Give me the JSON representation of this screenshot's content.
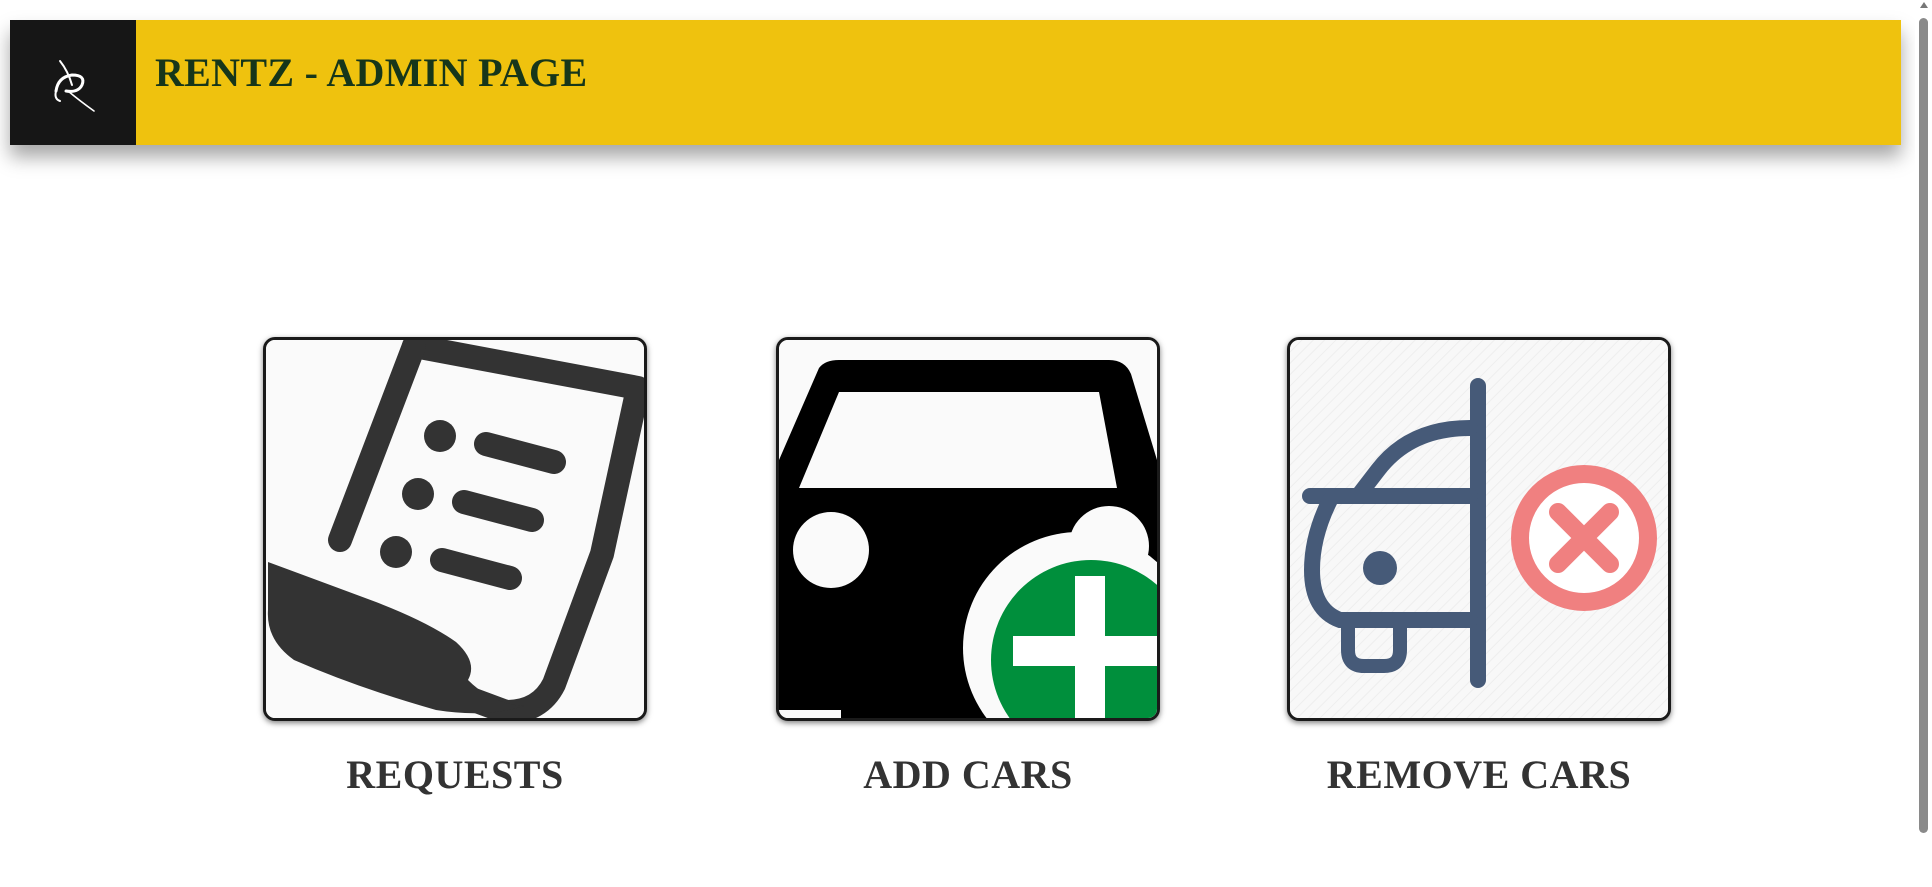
{
  "header": {
    "title": "RENTZ - ADMIN PAGE",
    "background_color": "#efc20e",
    "logo_background": "#161616",
    "logo_icon": "rentz-logo-icon",
    "title_color": "#16361a"
  },
  "cards": [
    {
      "label": "REQUESTS",
      "icon": "document-list-icon"
    },
    {
      "label": "ADD CARS",
      "icon": "car-add-icon",
      "accent_color": "#008f3c"
    },
    {
      "label": "REMOVE CARS",
      "icon": "car-remove-icon",
      "accent_color": "#f08080",
      "icon_color": "#465a78"
    }
  ]
}
